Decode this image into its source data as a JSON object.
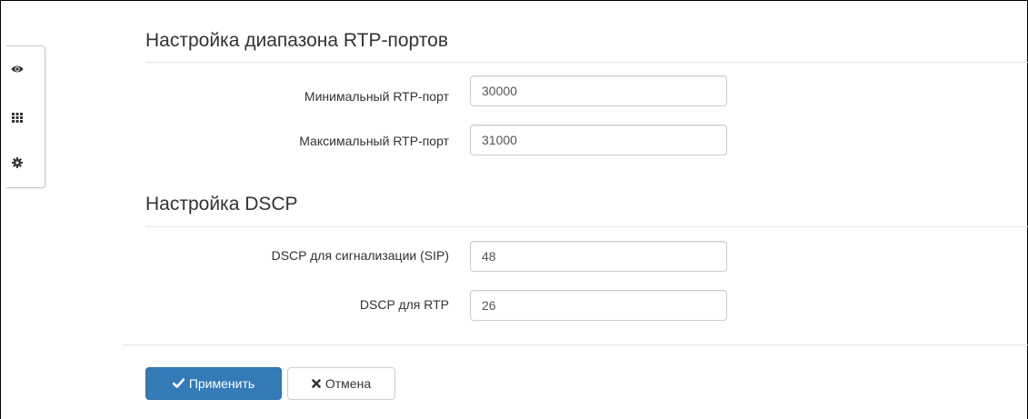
{
  "toolbar": {
    "icons": [
      "eye-icon",
      "grid-icon",
      "gear-icon"
    ]
  },
  "rtp_section": {
    "title": "Настройка диапазона RTP-портов",
    "min_port_label": "Минимальный RTP-порт",
    "min_port_value": "30000",
    "max_port_label": "Максимальный RTP-порт",
    "max_port_value": "31000"
  },
  "dscp_section": {
    "title": "Настройка DSCP",
    "sip_label": "DSCP для сигнализации (SIP)",
    "sip_value": "48",
    "rtp_label": "DSCP для RTP",
    "rtp_value": "26"
  },
  "actions": {
    "apply_label": "Применить",
    "cancel_label": "Отмена"
  },
  "colors": {
    "primary": "#337ab7",
    "border": "#cccccc",
    "text": "#333333"
  }
}
